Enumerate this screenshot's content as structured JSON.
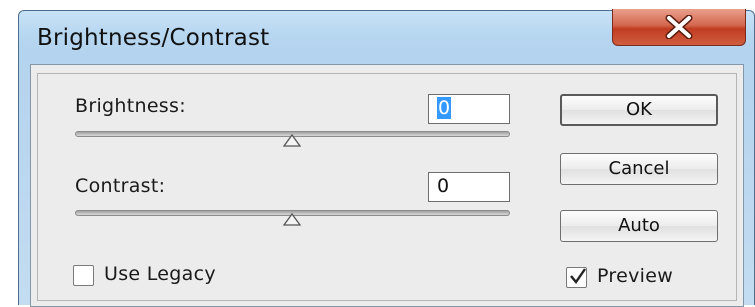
{
  "dialog": {
    "title": "Brightness/Contrast",
    "close_symbol": "X"
  },
  "brightness": {
    "label": "Brightness:",
    "value": "0",
    "slider_level": 0.5
  },
  "contrast": {
    "label": "Contrast:",
    "value": "0",
    "slider_level": 0.5
  },
  "buttons": {
    "ok": "OK",
    "cancel": "Cancel",
    "auto": "Auto"
  },
  "options": {
    "use_legacy_label": "Use Legacy",
    "use_legacy_checked": false,
    "preview_label": "Preview",
    "preview_checked": true
  },
  "colors": {
    "titlebar": "#b7d6f0",
    "close_button": "#c13c21",
    "selection": "#3399ff"
  }
}
